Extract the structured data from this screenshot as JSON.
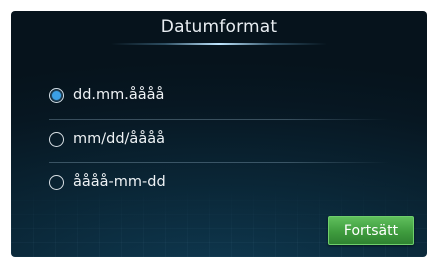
{
  "header": {
    "title": "Datumformat"
  },
  "date_format": {
    "selected_index": 0,
    "options": [
      {
        "label": "dd.mm.åååå",
        "selected": true,
        "icon": "radio-selected-icon"
      },
      {
        "label": "mm/dd/åååå",
        "selected": false,
        "icon": "radio-unselected-icon"
      },
      {
        "label": "åååå-mm-dd",
        "selected": false,
        "icon": "radio-unselected-icon"
      }
    ]
  },
  "footer": {
    "continue_label": "Fortsätt"
  },
  "colors": {
    "background": "#0a2636",
    "accent_blue": "#3ba0e6",
    "button_green": "#4aa848",
    "text": "#eef2f5"
  }
}
